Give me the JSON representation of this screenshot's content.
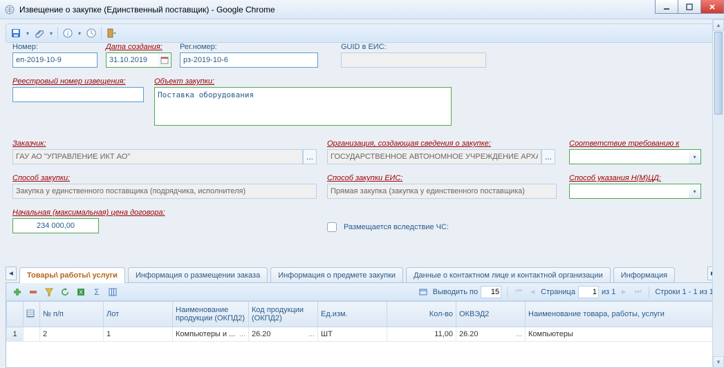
{
  "window": {
    "title": "Извещение о закупке (Единственный поставщик) - Google Chrome"
  },
  "toolbar_icons": {
    "save": "save-icon",
    "attach": "paperclip-icon",
    "info": "info-icon",
    "history": "clock-icon",
    "exit": "door-icon"
  },
  "labels": {
    "number": "Номер:",
    "date_created": "Дата создания:",
    "reg_number": "Рег.номер:",
    "guid": "GUID в ЕИС:",
    "registry_number": "Реестровый номер извещения:",
    "object": "Объект закупки:",
    "customer": "Заказчик:",
    "org_creator": "Организация, создающая сведения о закупке:",
    "compliance": "Соответствие требованию к",
    "purchase_method": "Способ закупки:",
    "purchase_method_eis": "Способ закупки ЕИС:",
    "nmcd_method": "Способ указания Н(М)ЦД:",
    "initial_price": "Начальная (максимальная) цена договора:",
    "chs": "Размещается вследствие ЧС:"
  },
  "fields": {
    "number": "еп-2019-10-9",
    "date_created": "31.10.2019",
    "reg_number": "рз-2019-10-6",
    "guid": "",
    "registry_number": "",
    "object": "Поставка оборудования",
    "customer": "ГАУ АО \"УПРАВЛЕНИЕ ИКТ АО\"",
    "org_creator": "ГОСУДАРСТВЕННОЕ АВТОНОМНОЕ УЧРЕЖДЕНИЕ АРХАН",
    "compliance": "",
    "purchase_method": "Закупка у единственного поставщика (подрядчика, исполнителя)",
    "purchase_method_eis": "Прямая закупка (закупка у единственного поставщика)",
    "nmcd_method": "",
    "initial_price": "234 000,00"
  },
  "tabs": [
    {
      "label": "Товары\\ работы\\ услуги",
      "active": true
    },
    {
      "label": "Информация о размещении заказа",
      "active": false
    },
    {
      "label": "Информация о предмете закупки",
      "active": false
    },
    {
      "label": "Данные о контактном лице и контактной организации",
      "active": false
    },
    {
      "label": "Информация",
      "active": false
    }
  ],
  "pager": {
    "output_by_label": "Выводить по",
    "output_by_value": "15",
    "page_label": "Страница",
    "page_value": "1",
    "of_label": "из 1",
    "rows_label": "Строки 1 - 1 из 1"
  },
  "grid": {
    "columns": [
      "",
      "№ п/п",
      "Лот",
      "Наименование продукции (ОКПД2)",
      "Код продукции (ОКПД2)",
      "Ед.изм.",
      "Кол-во",
      "ОКВЭД2",
      "Наименование товара, работы, услуги"
    ],
    "rows": [
      {
        "rownum": "1",
        "npp": "2",
        "lot": "1",
        "name_okpd2": "Компьютеры и ...",
        "code_okpd2": "26.20",
        "unit": "ШТ",
        "qty": "11,00",
        "okved2": "26.20",
        "goods_name": "Компьютеры"
      }
    ]
  },
  "colors": {
    "required": "#a00000",
    "accent": "#2a5a8a",
    "green_border": "#4fa84f"
  }
}
